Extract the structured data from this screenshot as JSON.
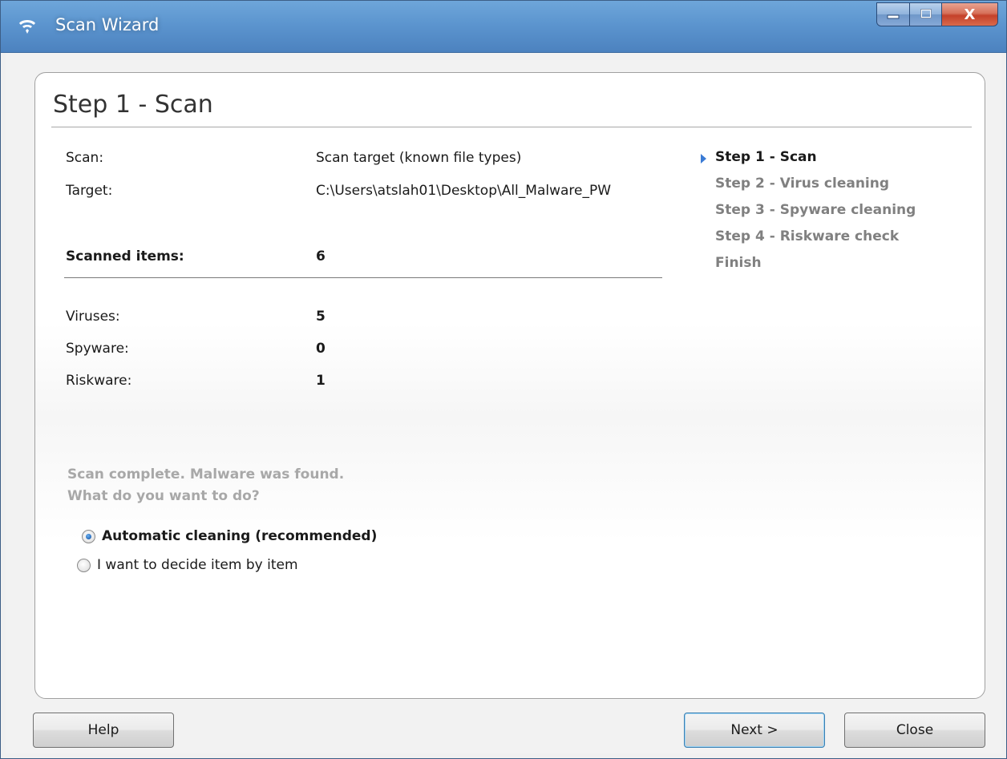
{
  "window": {
    "title": "Scan Wizard",
    "icon": "shield-icon"
  },
  "caption_buttons": {
    "minimize_icon": "minimize-icon",
    "maximize_icon": "maximize-icon",
    "close_label": "X"
  },
  "page": {
    "title": "Step 1 - Scan"
  },
  "summary": {
    "scan_label": "Scan:",
    "scan_value": "Scan target (known file types)",
    "target_label": "Target:",
    "target_value": "C:\\Users\\atslah01\\Desktop\\All_Malware_PW",
    "scanned_label": "Scanned items:",
    "scanned_value": "6",
    "viruses_label": "Viruses:",
    "viruses_value": "5",
    "spyware_label": "Spyware:",
    "spyware_value": "0",
    "riskware_label": "Riskware:",
    "riskware_value": "1"
  },
  "steps": [
    {
      "label": "Step 1 - Scan",
      "current": true
    },
    {
      "label": "Step 2 - Virus cleaning",
      "current": false
    },
    {
      "label": "Step 3 - Spyware cleaning",
      "current": false
    },
    {
      "label": "Step 4 - Riskware check",
      "current": false
    },
    {
      "label": "Finish",
      "current": false
    }
  ],
  "status": {
    "line1": "Scan complete. Malware was found.",
    "line2": "What do you want to do?"
  },
  "options": {
    "automatic": {
      "label": "Automatic cleaning (recommended)",
      "selected": true
    },
    "manual": {
      "label": "I want to decide item by item",
      "selected": false
    }
  },
  "buttons": {
    "help": "Help",
    "next": "Next >",
    "close": "Close"
  },
  "colors": {
    "titlebar": "#5c95cf",
    "accent_arrow": "#3a7bd5",
    "muted_text": "#a8a8a8"
  }
}
